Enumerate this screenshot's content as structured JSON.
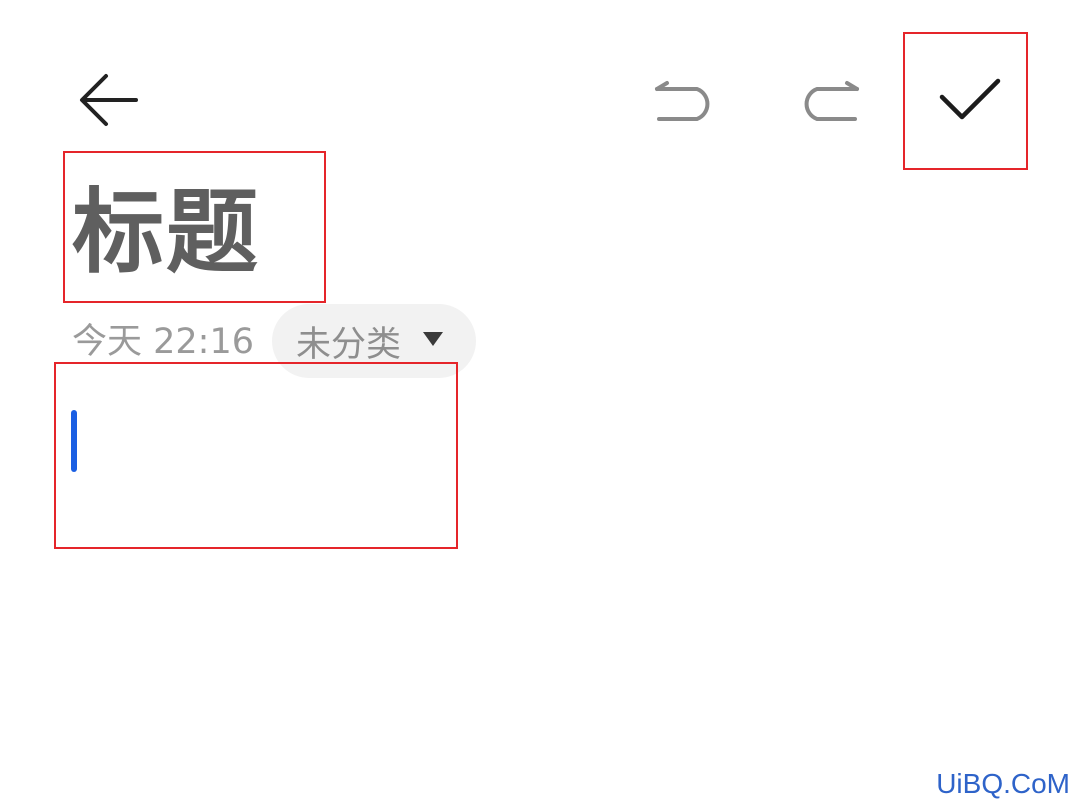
{
  "note": {
    "title": "标题",
    "timestamp": "今天 22:16",
    "category": "未分类",
    "body_value": ""
  },
  "toolbar": {
    "back_icon": "arrow-left-icon",
    "undo_icon": "undo-icon",
    "redo_icon": "redo-icon",
    "save_icon": "checkmark-icon"
  },
  "colors": {
    "highlight_box": "#e5252a",
    "cursor": "#1a5fe3",
    "title_text": "#5f5f5f",
    "meta_text": "#9a9a9a",
    "chip_background": "#f2f2f2",
    "watermark": "#2e63c9"
  },
  "watermark": "UiBQ.CoM"
}
